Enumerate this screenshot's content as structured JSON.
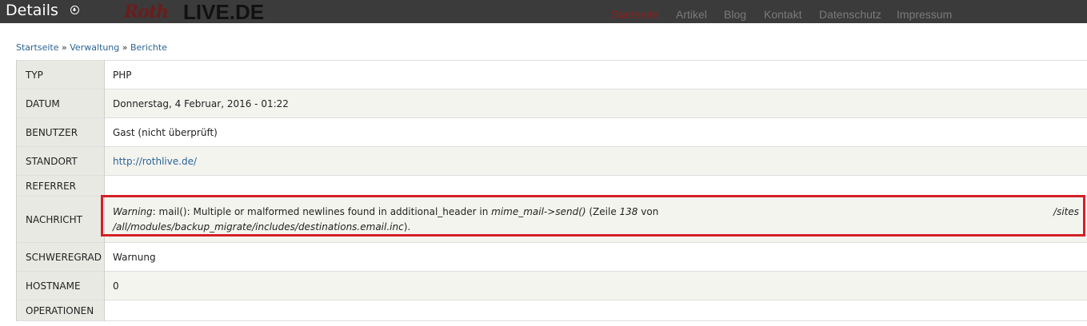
{
  "header": {
    "title": "Details",
    "logo_roth": "Roth",
    "logo_live": "LIVE.DE",
    "nav": [
      {
        "label": "Startseite",
        "active": true
      },
      {
        "label": "Artikel",
        "active": false
      },
      {
        "label": "Blog",
        "active": false
      },
      {
        "label": "Kontakt",
        "active": false
      },
      {
        "label": "Datenschutz",
        "active": false
      },
      {
        "label": "Impressum",
        "active": false
      }
    ]
  },
  "breadcrumb": {
    "items": [
      "Startseite",
      "Verwaltung",
      "Berichte"
    ],
    "separator": "»"
  },
  "details": {
    "typ_label": "TYP",
    "typ_value": "PHP",
    "datum_label": "DATUM",
    "datum_value": "Donnerstag, 4 Februar, 2016 - 01:22",
    "benutzer_label": "BENUTZER",
    "benutzer_value": "Gast (nicht überprüft)",
    "standort_label": "STANDORT",
    "standort_value": "http://rothlive.de/",
    "referrer_label": "REFERRER",
    "referrer_value": "",
    "nachricht_label": "NACHRICHT",
    "nachricht": {
      "warning": "Warning",
      "text1": ": mail(): Multiple or malformed newlines found in additional_header in ",
      "function": "mime_mail->send()",
      "text2": " (Zeile ",
      "line": "138",
      "text3": " von",
      "path_start": "/sites",
      "path_rest": "/all/modules/backup_migrate/includes/destinations.email.inc",
      "text4": ")."
    },
    "schweregrad_label": "SCHWEREGRAD",
    "schweregrad_value": "Warnung",
    "hostname_label": "HOSTNAME",
    "hostname_value": "0",
    "operationen_label": "OPERATIONEN",
    "operationen_value": ""
  },
  "colors": {
    "topbar": "#3b3b3b",
    "highlight_border": "#d42027",
    "link": "#2a6496",
    "nav_active": "#8a1f1f"
  }
}
